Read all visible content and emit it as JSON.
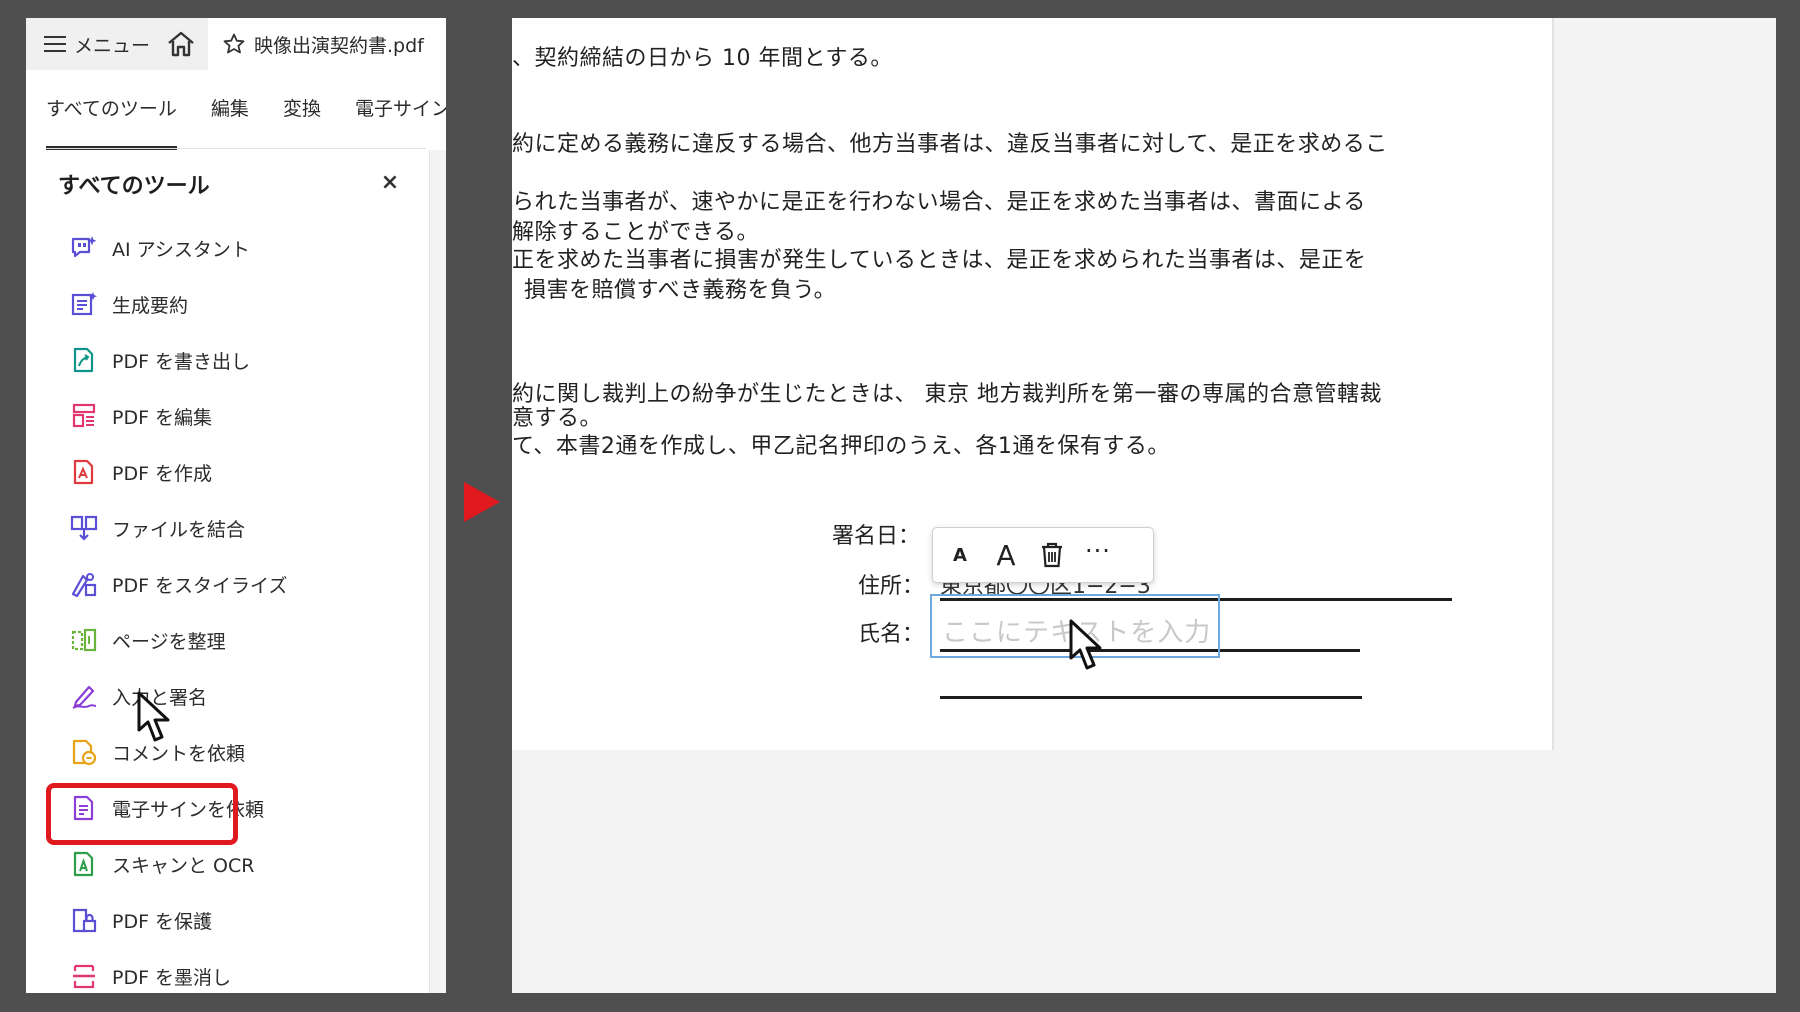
{
  "left_panel": {
    "menu_label": "メニュー",
    "doc_tab_title": "映像出演契約書.pdf",
    "tabs": [
      "すべてのツール",
      "編集",
      "変換",
      "電子サイン"
    ],
    "tools_header": "すべてのツール",
    "close_symbol": "×",
    "tools": [
      {
        "label": "AI アシスタント",
        "icon": "ai-assistant-icon",
        "color": "#5b4fd6"
      },
      {
        "label": "生成要約",
        "icon": "summary-icon",
        "color": "#5b4fd6"
      },
      {
        "label": "PDF を書き出し",
        "icon": "export-pdf-icon",
        "color": "#0f9488"
      },
      {
        "label": "PDF を編集",
        "icon": "edit-pdf-icon",
        "color": "#e2376e"
      },
      {
        "label": "PDF を作成",
        "icon": "create-pdf-icon",
        "color": "#e0393e"
      },
      {
        "label": "ファイルを結合",
        "icon": "combine-files-icon",
        "color": "#5b4fd6"
      },
      {
        "label": "PDF をスタイライズ",
        "icon": "stylize-pdf-icon",
        "color": "#5b4fd6"
      },
      {
        "label": "ページを整理",
        "icon": "organize-pages-icon",
        "color": "#6bb33c"
      },
      {
        "label": "入力と署名",
        "icon": "fill-sign-icon",
        "color": "#8b3fd6"
      },
      {
        "label": "コメントを依頼",
        "icon": "request-comments-icon",
        "color": "#e8a317"
      },
      {
        "label": "電子サインを依頼",
        "icon": "request-esign-icon",
        "color": "#8b3fd6"
      },
      {
        "label": "スキャンと OCR",
        "icon": "scan-ocr-icon",
        "color": "#2e9e4a"
      },
      {
        "label": "PDF を保護",
        "icon": "protect-pdf-icon",
        "color": "#5b4fd6"
      },
      {
        "label": "PDF を墨消し",
        "icon": "redact-pdf-icon",
        "color": "#e2376e"
      }
    ]
  },
  "document": {
    "lines": [
      "、契約締結の日から 10 年間とする。",
      "約に定める義務に違反する場合、他方当事者は、違反当事者に対して、是正を求めるこ",
      "られた当事者が、速やかに是正を行わない場合、是正を求めた当事者は、書面による",
      "解除することができる。",
      "正を求めた当事者に損害が発生しているときは、是正を求められた当事者は、是正を",
      "損害を賠償すべき義務を負う。",
      "約に関し裁判上の紛争が生じたときは、 東京 地方裁判所を第一審の専属的合意管轄裁",
      "意する。",
      "て、本書2通を作成し、甲乙記名押印のうえ、各1通を保有する。"
    ],
    "signature": {
      "date_label": "署名日：",
      "address_label": "住所：",
      "address_value": "東京都〇〇区1−2−3",
      "name_label": "氏名：",
      "name_placeholder": "ここにテキストを入力"
    },
    "toolbar": {
      "small_a": "A",
      "large_a": "A",
      "more": "···"
    }
  },
  "colors": {
    "highlight": "#e0191e",
    "arrow": "#e0191e",
    "input_border": "#6fa8dc"
  }
}
